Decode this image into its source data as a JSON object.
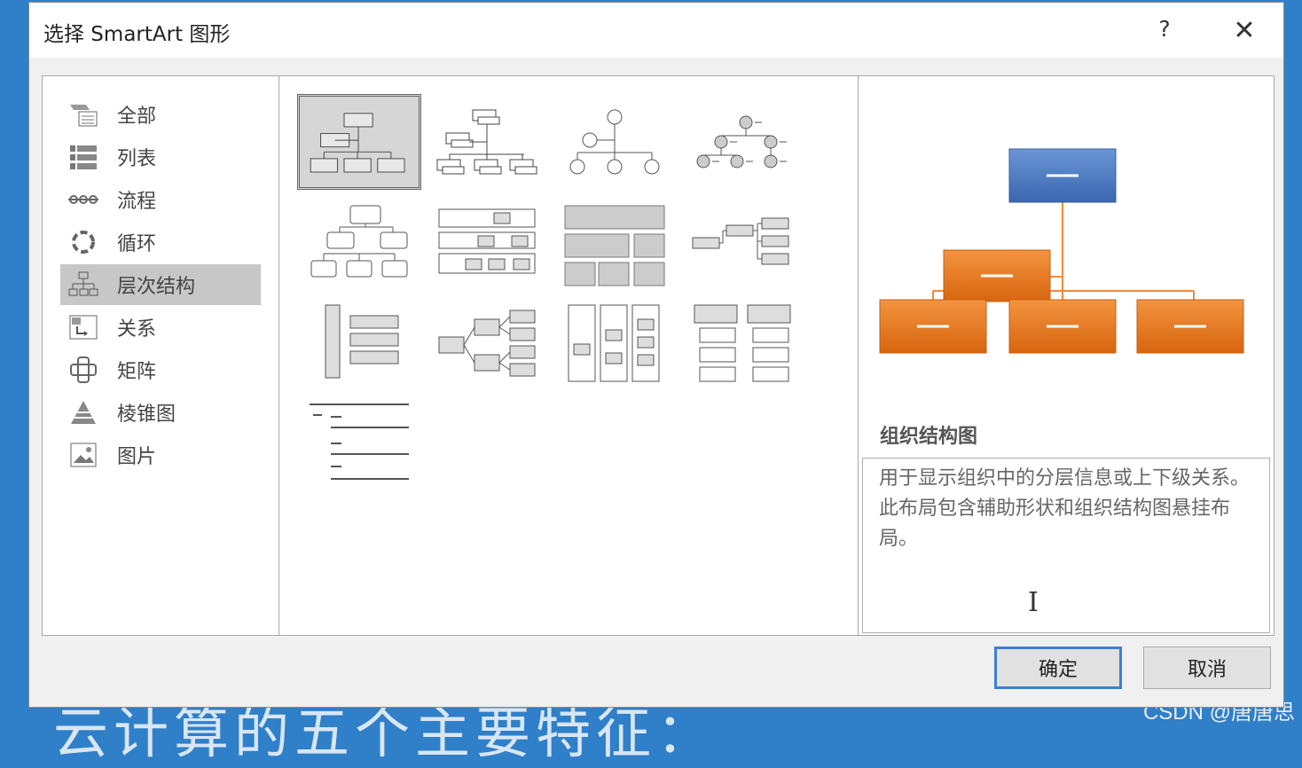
{
  "dialog": {
    "title": "选择 SmartArt 图形",
    "help_label": "?",
    "close_label": "✕"
  },
  "categories": [
    {
      "label": "全部",
      "icon": "all-icon"
    },
    {
      "label": "列表",
      "icon": "list-icon"
    },
    {
      "label": "流程",
      "icon": "process-icon"
    },
    {
      "label": "循环",
      "icon": "cycle-icon"
    },
    {
      "label": "层次结构",
      "icon": "hierarchy-icon",
      "selected": true
    },
    {
      "label": "关系",
      "icon": "relationship-icon"
    },
    {
      "label": "矩阵",
      "icon": "matrix-icon"
    },
    {
      "label": "棱锥图",
      "icon": "pyramid-icon"
    },
    {
      "label": "图片",
      "icon": "picture-icon"
    }
  ],
  "gallery": {
    "selected_index": 0,
    "count": 13
  },
  "preview": {
    "name": "组织结构图",
    "description": "用于显示组织中的分层信息或上下级关系。此布局包含辅助形状和组织结构图悬挂布局。",
    "cursor": "I",
    "colors": {
      "top": "#4a78c0",
      "child": "#e2731c",
      "line": "#f08a3c"
    }
  },
  "buttons": {
    "ok": "确定",
    "cancel": "取消"
  },
  "background": {
    "text": "云计算的五个主要特征："
  },
  "watermark": "CSDN @唐唐思"
}
